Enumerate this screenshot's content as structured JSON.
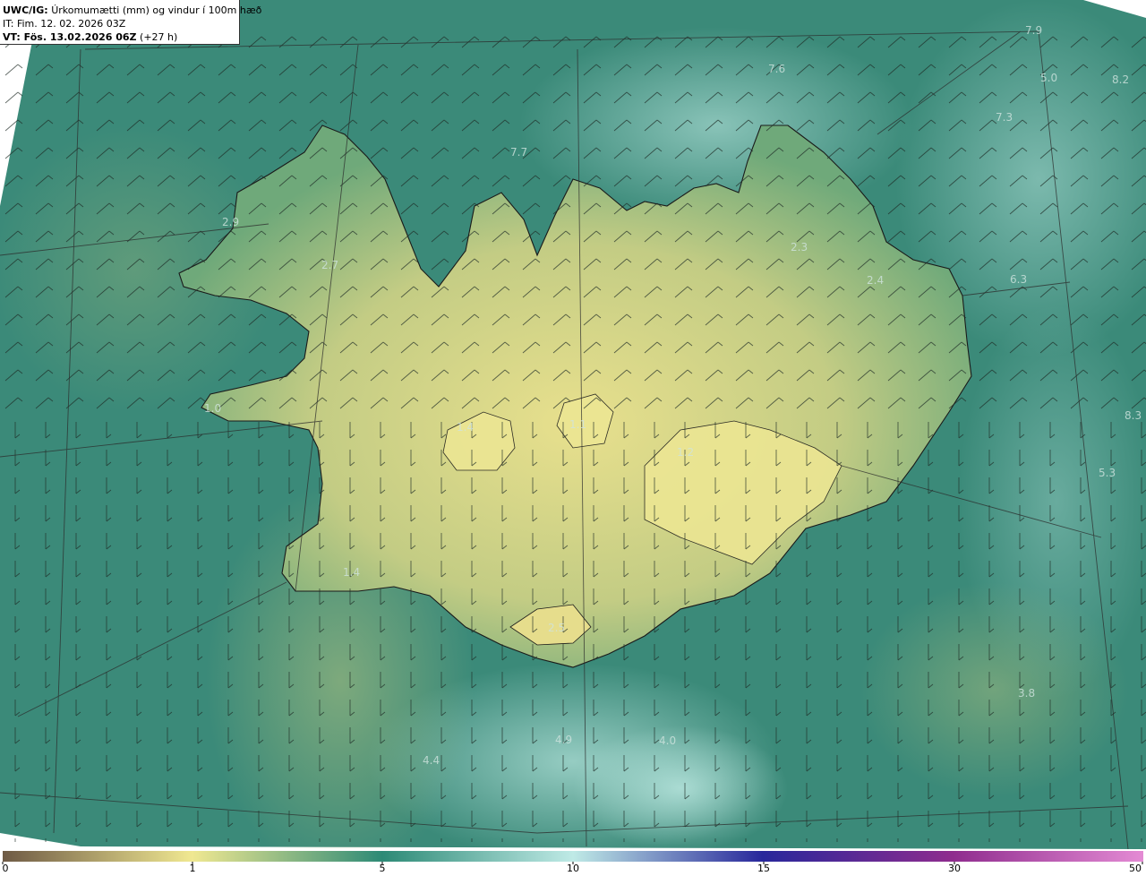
{
  "header": {
    "code": "UWC/IG:",
    "title": "Úrkomumætti (mm) og vindur í 100m hæð",
    "it_text": "IT: Fim. 12. 02. 2026 03Z",
    "vt_bold": "VT: Fös. 13.02.2026 06Z",
    "vt_offset": "(+27 h)"
  },
  "map_values": [
    {
      "value": "7.9"
    },
    {
      "value": "7.6"
    },
    {
      "value": "5.0"
    },
    {
      "value": "8.2"
    },
    {
      "value": "7.3"
    },
    {
      "value": "7.7"
    },
    {
      "value": "2.9"
    },
    {
      "value": "2.7"
    },
    {
      "value": "2.3"
    },
    {
      "value": "2.4"
    },
    {
      "value": "6.3"
    },
    {
      "value": "1.0"
    },
    {
      "value": "1.4"
    },
    {
      "value": "1.1"
    },
    {
      "value": "1.2"
    },
    {
      "value": "8.3"
    },
    {
      "value": "5.3"
    },
    {
      "value": "1.4"
    },
    {
      "value": "2.5"
    },
    {
      "value": "3.8"
    },
    {
      "value": "4.9"
    },
    {
      "value": "4.0"
    },
    {
      "value": "4.4"
    }
  ],
  "colorbar": {
    "ticks": [
      "0",
      "1",
      "5",
      "10",
      "15",
      "30",
      "50"
    ],
    "colors": {
      "c0": "#6e5a45",
      "c1": "#f0e891",
      "c2": "#2d8a76",
      "c3": "#bfeae6",
      "c4": "#28279b",
      "c5": "#8f2c8e",
      "c6": "#e48bd4"
    }
  },
  "map_colors": {
    "sea": "#3a8d7c",
    "land": "#e5dc8a",
    "land_green": "#8fb878",
    "highlight": "#9fd8d0"
  }
}
